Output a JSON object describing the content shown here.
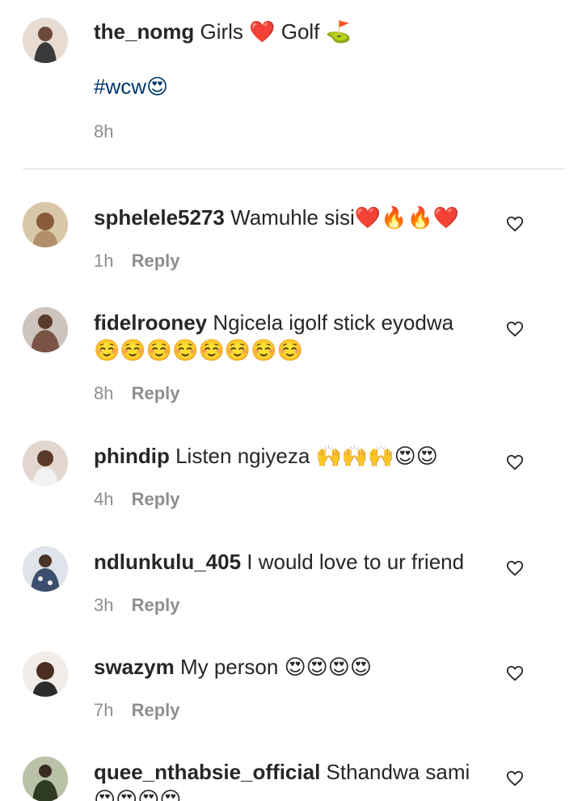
{
  "caption": {
    "username": "the_nomg",
    "text": "Girls ❤️ Golf ⛳",
    "hashtag": "#wcw😍",
    "time": "8h"
  },
  "comments": [
    {
      "username": "sphelele5273",
      "text": "Wamuhle sisi❤️🔥🔥❤️",
      "time": "1h",
      "reply": "Reply",
      "avatar_color": "#c9b59a"
    },
    {
      "username": "fidelrooney",
      "text": "Ngicela igolf stick eyodwa",
      "text2": "☺️☺️☺️☺️☺️☺️☺️☺️",
      "time": "8h",
      "reply": "Reply",
      "avatar_color": "#8a7a74"
    },
    {
      "username": "phindip",
      "text": "Listen ngiyeza 🙌🙌🙌😍😍",
      "time": "4h",
      "reply": "Reply",
      "avatar_color": "#c7a48f"
    },
    {
      "username": "ndlunkulu_405",
      "text": "I would love to ur friend",
      "time": "3h",
      "reply": "Reply",
      "avatar_color": "#9eaec2"
    },
    {
      "username": "swazym",
      "text": "My person 😍😍😍😍",
      "time": "7h",
      "reply": "Reply",
      "avatar_color": "#6b4b3b"
    },
    {
      "username": "quee_nthabsie_official",
      "text": "Sthandwa sami",
      "text2": "😍😍😍😍",
      "avatar_color": "#4a5a3a"
    }
  ],
  "icons": {
    "like": "heart-outline-icon"
  }
}
